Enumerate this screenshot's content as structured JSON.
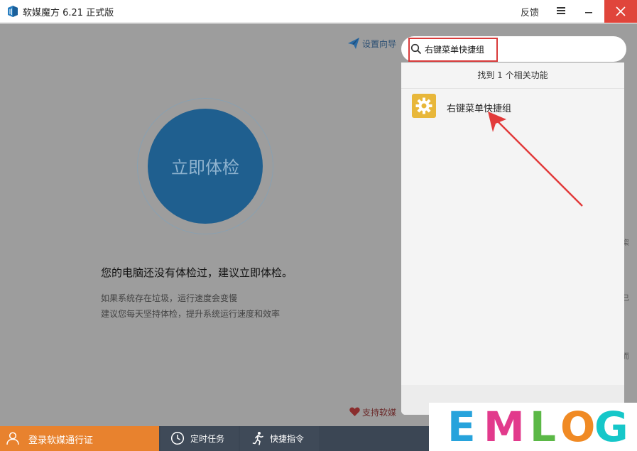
{
  "window": {
    "title": "软媒魔方 6.21 正式版",
    "feedback_label": "反馈",
    "icons": {
      "menu": "hamburger-menu-icon",
      "minimize": "minimize-icon",
      "close": "close-icon"
    },
    "colors": {
      "close": "#e0453b"
    }
  },
  "main": {
    "setup_wizard_label": "设置向导",
    "check_button_label": "立即体检",
    "status_text": "您的电脑还没有体检过，建议立即体检。",
    "tips": [
      "如果系统存在垃圾，运行速度会变慢",
      "建议您每天坚持体检，提升系统运行速度和效率"
    ],
    "support_label": "支持软媒",
    "edge_glyphs": [
      "栥",
      "己",
      "而"
    ]
  },
  "search": {
    "value": "右键菜单快捷组",
    "results_summary": "找到 1 个相关功能",
    "results": [
      {
        "label": "右键菜单快捷组",
        "icon": "gear-icon"
      }
    ]
  },
  "bottom_bar": {
    "login_label": "登录软媒通行证",
    "scheduled_tasks_label": "定时任务",
    "quick_commands_label": "快捷指令",
    "colors": {
      "login": "#e8822e",
      "bar": "#3b4654"
    }
  },
  "watermark": {
    "letters": [
      "E",
      "M",
      "L",
      "O",
      "G"
    ],
    "colors": [
      "#27a3dc",
      "#e23a8c",
      "#5bb846",
      "#f08a24",
      "#16c7c9"
    ]
  },
  "annotation": {
    "highlight_color": "#d93b3b"
  }
}
